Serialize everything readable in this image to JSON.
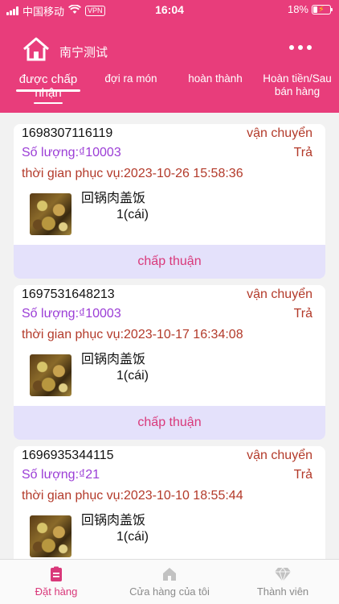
{
  "status_bar": {
    "carrier": "中国移动",
    "vpn": "VPN",
    "time": "16:04",
    "battery": "18%"
  },
  "header": {
    "store_name": "南宁测试",
    "home_icon": "home-icon",
    "more_icon": "more-dots-icon"
  },
  "tabs": [
    {
      "label": "được chấp nhận"
    },
    {
      "label": "đợi ra món"
    },
    {
      "label": "hoàn thành"
    },
    {
      "label": "Hoàn tiền/Sau bán hàng"
    }
  ],
  "orders": [
    {
      "order_id": "1698307116119",
      "delivery": "vận chuyển",
      "quantity": "Số lượng:₫10003",
      "payment": "Trả",
      "service_time": "thời gian phục vụ:2023-10-26 15:58:36",
      "dish": "回锅肉盖饭",
      "count": "1(cái)",
      "accept_label": "chấp thuận"
    },
    {
      "order_id": "1697531648213",
      "delivery": "vận chuyển",
      "quantity": "Số lượng:₫10003",
      "payment": "Trả",
      "service_time": "thời gian phục vụ:2023-10-17 16:34:08",
      "dish": "回锅肉盖饭",
      "count": "1(cái)",
      "accept_label": "chấp thuận"
    },
    {
      "order_id": "1696935344115",
      "delivery": "vận chuyển",
      "quantity": "Số lượng:₫21",
      "payment": "Trả",
      "service_time": "thời gian phục vụ:2023-10-10 18:55:44",
      "dish": "回锅肉盖饭",
      "count": "1(cái)"
    }
  ],
  "bottom_nav": [
    {
      "label": "Đặt hàng",
      "icon": "clipboard-icon"
    },
    {
      "label": "Cửa hàng của tôi",
      "icon": "store-icon"
    },
    {
      "label": "Thành viên",
      "icon": "diamond-icon"
    }
  ],
  "colors": {
    "brand": "#e83d7b",
    "delivery_text": "#b33a2a",
    "quantity_text": "#9b3dd6",
    "accept_bg": "#e4e1fb",
    "accept_text": "#d9387a"
  }
}
